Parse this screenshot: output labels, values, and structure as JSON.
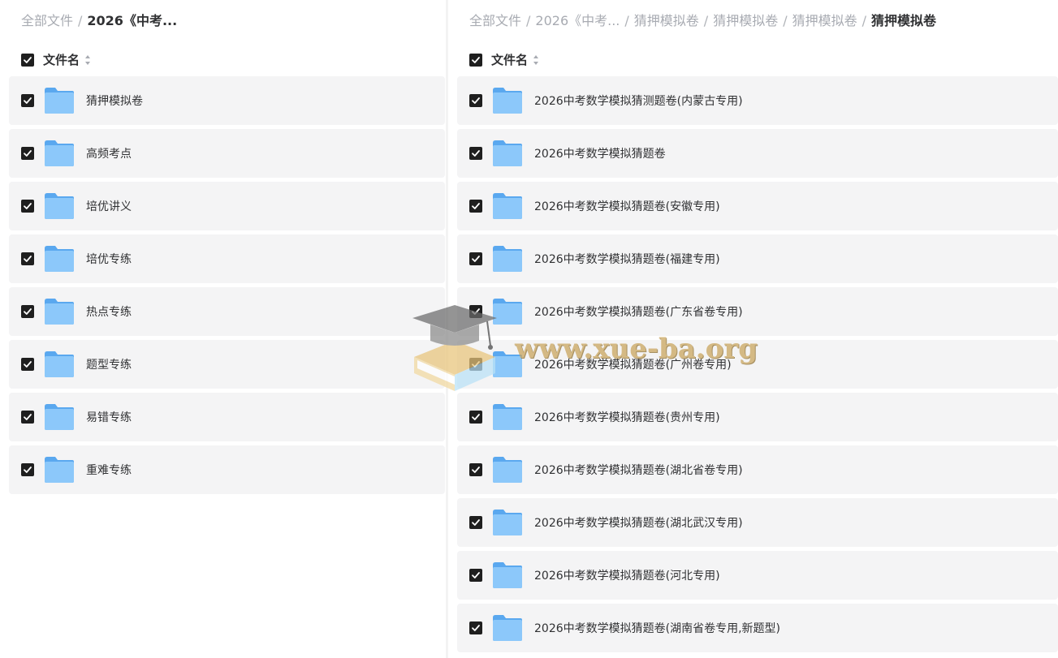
{
  "left_panel": {
    "breadcrumb": [
      {
        "label": "全部文件",
        "current": false
      },
      {
        "label": "2026《中考...",
        "current": true
      }
    ],
    "header": {
      "column_label": "文件名",
      "checked": true
    },
    "rows": [
      {
        "name": "猜押模拟卷",
        "checked": true,
        "icon": "folder-icon"
      },
      {
        "name": "高频考点",
        "checked": true,
        "icon": "folder-icon"
      },
      {
        "name": "培优讲义",
        "checked": true,
        "icon": "folder-icon"
      },
      {
        "name": "培优专练",
        "checked": true,
        "icon": "folder-icon"
      },
      {
        "name": "热点专练",
        "checked": true,
        "icon": "folder-icon"
      },
      {
        "name": "题型专练",
        "checked": true,
        "icon": "folder-icon"
      },
      {
        "name": "易错专练",
        "checked": true,
        "icon": "folder-icon"
      },
      {
        "name": "重难专练",
        "checked": true,
        "icon": "folder-icon"
      }
    ]
  },
  "right_panel": {
    "breadcrumb": [
      {
        "label": "全部文件",
        "current": false
      },
      {
        "label": "2026《中考...",
        "current": false
      },
      {
        "label": "猜押模拟卷",
        "current": false
      },
      {
        "label": "猜押模拟卷",
        "current": false
      },
      {
        "label": "猜押模拟卷",
        "current": false
      },
      {
        "label": "猜押模拟卷",
        "current": true
      }
    ],
    "header": {
      "column_label": "文件名",
      "checked": true
    },
    "rows": [
      {
        "name": "2026中考数学模拟猜测题卷(内蒙古专用)",
        "checked": true,
        "icon": "folder-icon"
      },
      {
        "name": "2026中考数学模拟猜题卷",
        "checked": true,
        "icon": "folder-icon"
      },
      {
        "name": "2026中考数学模拟猜题卷(安徽专用)",
        "checked": true,
        "icon": "folder-icon"
      },
      {
        "name": "2026中考数学模拟猜题卷(福建专用)",
        "checked": true,
        "icon": "folder-icon"
      },
      {
        "name": "2026中考数学模拟猜题卷(广东省卷专用)",
        "checked": true,
        "icon": "folder-icon"
      },
      {
        "name": "2026中考数学模拟猜题卷(广州卷专用)",
        "checked": true,
        "icon": "folder-icon"
      },
      {
        "name": "2026中考数学模拟猜题卷(贵州专用)",
        "checked": true,
        "icon": "folder-icon"
      },
      {
        "name": "2026中考数学模拟猜题卷(湖北省卷专用)",
        "checked": true,
        "icon": "folder-icon"
      },
      {
        "name": "2026中考数学模拟猜题卷(湖北武汉专用)",
        "checked": true,
        "icon": "folder-icon"
      },
      {
        "name": "2026中考数学模拟猜题卷(河北专用)",
        "checked": true,
        "icon": "folder-icon"
      },
      {
        "name": "2026中考数学模拟猜题卷(湖南省卷专用,新题型)",
        "checked": true,
        "icon": "folder-icon"
      }
    ]
  },
  "watermark": {
    "text": "www.xue-ba.org",
    "icon": "graduation-cap-book-icon"
  },
  "colors": {
    "page_background": "#f3f3f3",
    "panel_background": "#ffffff",
    "row_background": "#f4f4f5",
    "checkbox": "#1f1f1f",
    "breadcrumb_muted": "#a8abb2",
    "folder_blue": "#6fb6f5",
    "watermark_gold": "#c9a35a"
  }
}
